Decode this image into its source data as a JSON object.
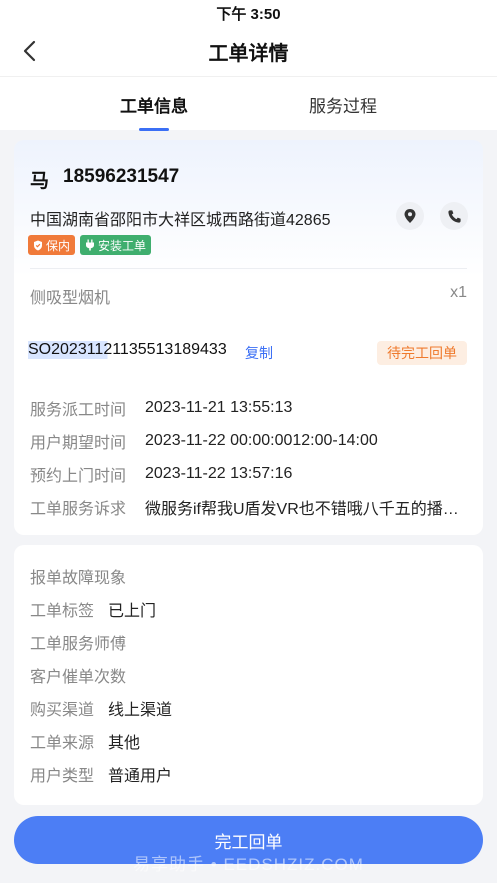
{
  "status_bar": {
    "time": "下午 3:50"
  },
  "nav": {
    "title": "工单详情"
  },
  "tabs": [
    {
      "label": "工单信息",
      "active": true
    },
    {
      "label": "服务过程",
      "active": false
    }
  ],
  "customer": {
    "name": "马",
    "phone": "18596231547",
    "address": "中国湖南省邵阳市大祥区城西路街道42865",
    "tags": [
      {
        "label": "保内",
        "color": "#f07a3a",
        "icon": "shield-icon"
      },
      {
        "label": "安装工单",
        "color": "#3fae6e",
        "icon": "plug-icon"
      }
    ],
    "product": "侧吸型烟机",
    "quantity": "x1"
  },
  "order": {
    "number": "SO20231121135513189433",
    "copy_label": "复制",
    "status": "待完工回单",
    "fields": [
      {
        "key": "服务派工时间",
        "value": "2023-11-21 13:55:13"
      },
      {
        "key": "用户期望时间",
        "value": "2023-11-22 00:00:0012:00-14:00"
      },
      {
        "key": "预约上门时间",
        "value": "2023-11-22 13:57:16"
      },
      {
        "key": "工单服务诉求",
        "value": "微服务if帮我U盾发VR也不错哦八千五的播…"
      }
    ]
  },
  "extra": {
    "fields": [
      {
        "key": "报单故障现象",
        "value": ""
      },
      {
        "key": "工单标签",
        "value": "已上门"
      },
      {
        "key": "工单服务师傅",
        "value": ""
      },
      {
        "key": "客户催单次数",
        "value": ""
      },
      {
        "key": "购买渠道",
        "value": "线上渠道"
      },
      {
        "key": "工单来源",
        "value": "其他"
      },
      {
        "key": "用户类型",
        "value": "普通用户"
      }
    ]
  },
  "footer": {
    "complete_label": "完工回单",
    "watermark": "易享助手 • EEDSHZIZ.COM"
  },
  "colors": {
    "accent": "#4c7ef5",
    "status_orange": "#ef7a2d",
    "tag_orange": "#f07a3a",
    "tag_green": "#3fae6e"
  }
}
